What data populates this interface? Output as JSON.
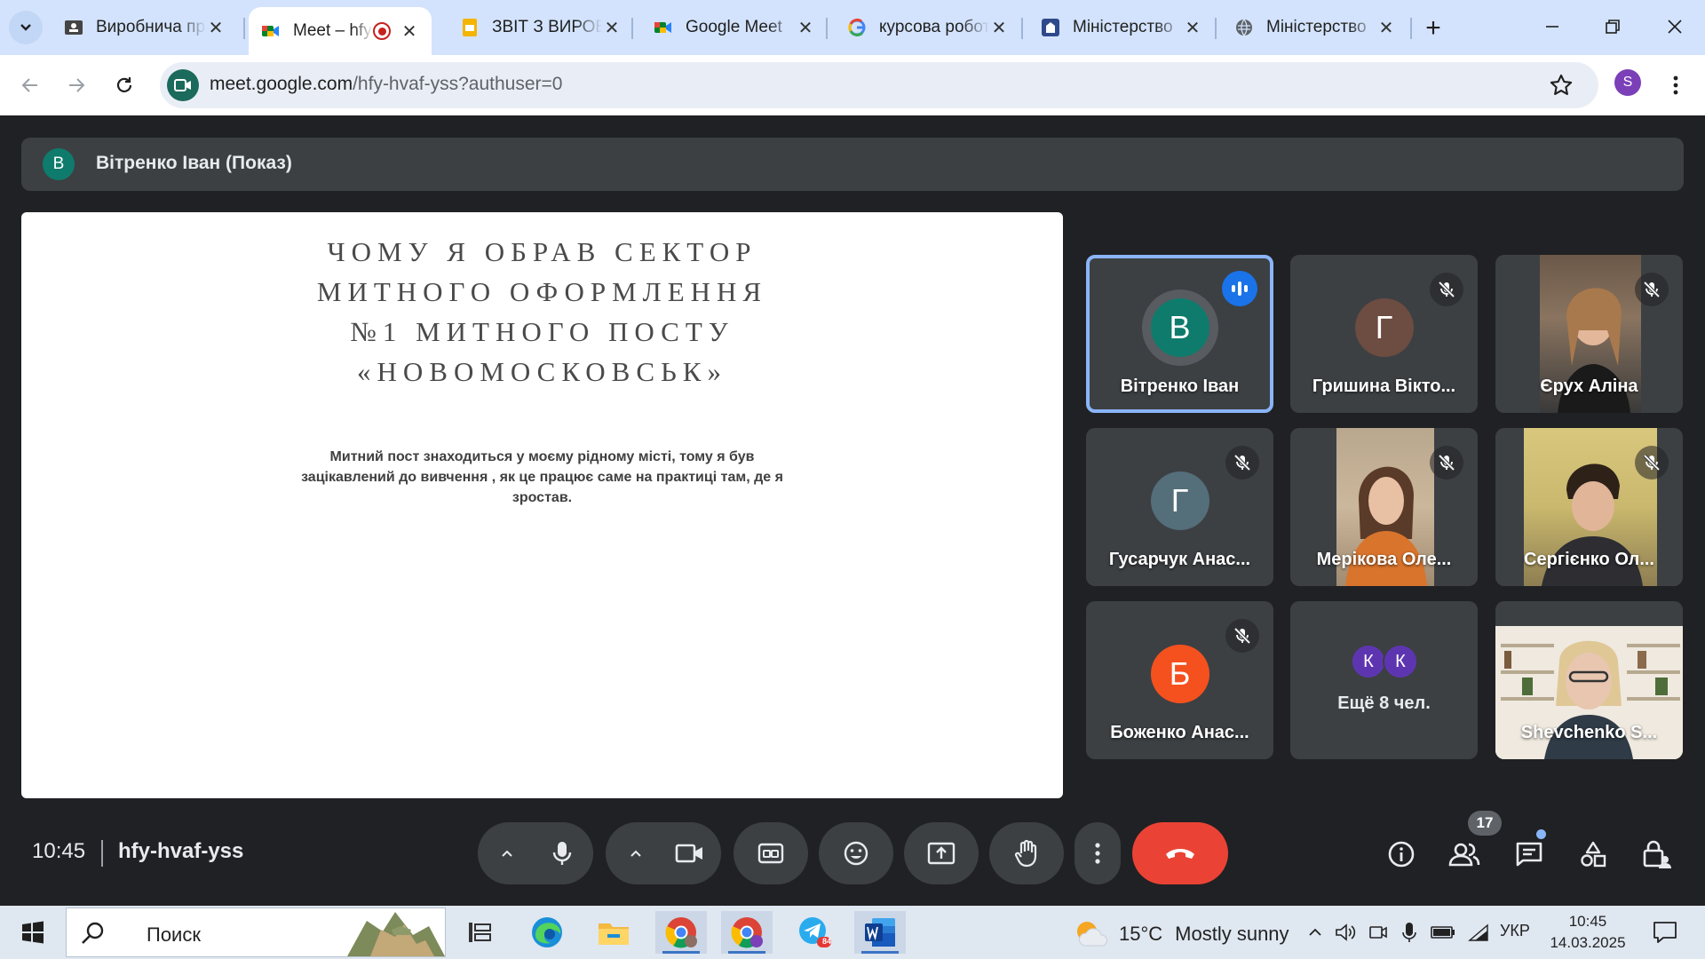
{
  "browser": {
    "tabs": [
      {
        "title": "Виробнича практика",
        "favicon": "classroom-icon",
        "active": false
      },
      {
        "title": "Meet – hfy-hvaf-yss",
        "favicon": "meet-icon",
        "active": true,
        "recording": true
      },
      {
        "title": "ЗВІТ З ВИРОБНИЧОЇ",
        "favicon": "slides-icon",
        "active": false
      },
      {
        "title": "Google Meet",
        "favicon": "meet-icon",
        "active": false
      },
      {
        "title": "курсова робота",
        "favicon": "google-icon",
        "active": false
      },
      {
        "title": "Міністерство",
        "favicon": "ministry-icon",
        "active": false
      },
      {
        "title": "Міністерство",
        "favicon": "globe-icon",
        "active": false
      }
    ],
    "url_host": "meet.google.com",
    "url_path": "/hfy-hvaf-yss?authuser=0",
    "profile_initial": "S",
    "tab_strip_color": "#d3e3fd"
  },
  "meet": {
    "presenter": {
      "initial": "В",
      "label": "Вітренко Іван (Показ)"
    },
    "slide": {
      "title": "ЧОМУ Я ОБРАВ СЕКТОР МИТНОГО ОФОРМЛЕННЯ №1 МИТНОГО ПОСТУ «НОВОМОСКОВСЬК»",
      "title_lines": [
        "ЧОМУ Я ОБРАВ СЕКТОР",
        "МИТНОГО ОФОРМЛЕННЯ",
        "№1 МИТНОГО ПОСТУ",
        "«НОВОМОСКОВСЬК»"
      ],
      "body_lines": [
        "Митний пост знаходиться у моєму рідному місті, тому я був",
        "зацікавлений до вивчення , як це працює саме на практиці там,  де я",
        "зростав."
      ]
    },
    "participants": [
      {
        "name": "Вітренко Іван",
        "initial": "В",
        "color": "#0f7b6c",
        "speaking": true,
        "muted": false
      },
      {
        "name": "Гришина Вікто...",
        "initial": "Г",
        "color": "#6d4c41",
        "muted": true
      },
      {
        "name": "Єрух Аліна",
        "video": true,
        "muted": true
      },
      {
        "name": "Гусарчук Анас...",
        "initial": "Г",
        "color": "#546e7a",
        "muted": true
      },
      {
        "name": "Мерікова Оле...",
        "video": true,
        "muted": true
      },
      {
        "name": "Сергієнко Ол...",
        "video": true,
        "muted": true
      },
      {
        "name": "Боженко Анас...",
        "initial": "Б",
        "color": "#f4511e",
        "muted": true
      },
      {
        "name": "Shevchenko S...",
        "video": true,
        "muted": false
      }
    ],
    "more": {
      "initials": [
        "К",
        "К"
      ],
      "label": "Ещё 8 чел."
    },
    "controls": {
      "time": "10:45",
      "meeting_code": "hfy-hvaf-yss",
      "participants_count": "17",
      "hangup_color": "#ea4335"
    }
  },
  "taskbar": {
    "search_label": "Поиск",
    "weather_temp": "15°C",
    "weather_text": "Mostly sunny",
    "language": "УКР",
    "time": "10:45",
    "date": "14.03.2025",
    "telegram_badge": "84"
  }
}
